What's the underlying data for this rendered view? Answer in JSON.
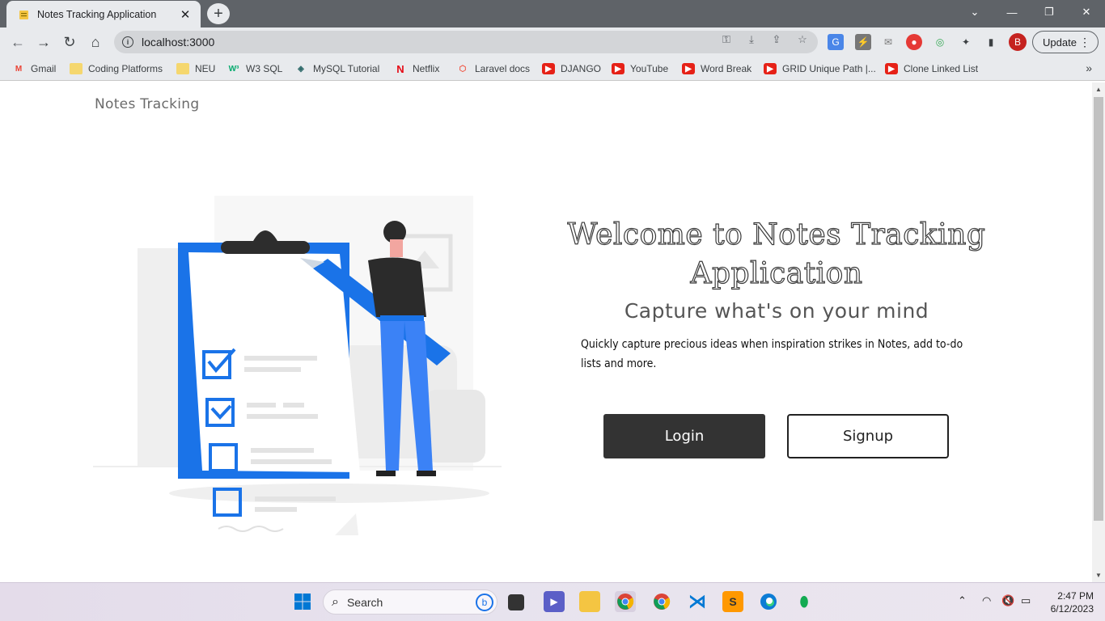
{
  "browser": {
    "tab_title": "Notes Tracking Application",
    "url": "localhost:3000",
    "update_label": "Update",
    "profile_initial": "B"
  },
  "bookmarks": [
    {
      "label": "Gmail",
      "icon": "gmail-icon"
    },
    {
      "label": "Coding Platforms",
      "icon": "folder-icon"
    },
    {
      "label": "NEU",
      "icon": "folder-icon"
    },
    {
      "label": "W3 SQL",
      "icon": "w3-icon"
    },
    {
      "label": "MySQL Tutorial",
      "icon": "mysql-icon"
    },
    {
      "label": "Netflix",
      "icon": "netflix-icon"
    },
    {
      "label": "Laravel docs",
      "icon": "laravel-icon"
    },
    {
      "label": "DJANGO",
      "icon": "youtube-icon"
    },
    {
      "label": "YouTube",
      "icon": "youtube-icon"
    },
    {
      "label": "Word Break",
      "icon": "youtube-icon"
    },
    {
      "label": "GRID Unique Path |...",
      "icon": "youtube-icon"
    },
    {
      "label": "Clone Linked List",
      "icon": "youtube-icon"
    }
  ],
  "page": {
    "brand": "Notes Tracking",
    "welcome": "Welcome to Notes Tracking Application",
    "tagline": "Capture what's on your mind",
    "description": "Quickly capture precious ideas when inspiration strikes in Notes, add to-do lists and more.",
    "login_label": "Login",
    "signup_label": "Signup"
  },
  "taskbar": {
    "search_label": "Search",
    "time": "2:47 PM",
    "date": "6/12/2023"
  },
  "colors": {
    "accent_blue": "#1a73e8",
    "button_dark": "#333333"
  }
}
